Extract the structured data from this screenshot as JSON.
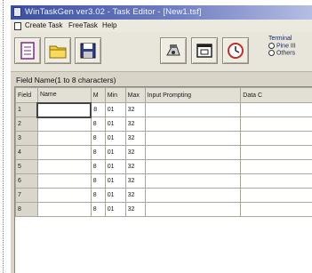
{
  "window": {
    "title": "WinTaskGen ver3.02 - Task Editor - [New1.tsf]"
  },
  "menu": {
    "items": [
      "Create Task",
      "FreeTask",
      "Help"
    ]
  },
  "toolbar": {
    "buttons": [
      {
        "icon": "new-document-icon"
      },
      {
        "icon": "open-folder-icon"
      },
      {
        "icon": "save-disk-icon"
      },
      {
        "icon": "terminal-device-icon"
      },
      {
        "icon": "window-icon"
      },
      {
        "icon": "clock-icon"
      }
    ],
    "terminal": {
      "label": "Terminal",
      "options": [
        "Pine III",
        "Others"
      ]
    }
  },
  "field_caption": "Field Name(1 to 8 characters)",
  "grid": {
    "columns": [
      "Field",
      "Name",
      "M",
      "Min",
      "Max",
      "Input Prompting",
      "Data C"
    ],
    "rows": [
      {
        "field": "1",
        "name": "",
        "m": "8",
        "min": "01",
        "max": "32"
      },
      {
        "field": "2",
        "name": "",
        "m": "8",
        "min": "01",
        "max": "32"
      },
      {
        "field": "3",
        "name": "",
        "m": "8",
        "min": "01",
        "max": "32"
      },
      {
        "field": "4",
        "name": "",
        "m": "8",
        "min": "01",
        "max": "32"
      },
      {
        "field": "5",
        "name": "",
        "m": "8",
        "min": "01",
        "max": "32"
      },
      {
        "field": "6",
        "name": "",
        "m": "8",
        "min": "01",
        "max": "32"
      },
      {
        "field": "7",
        "name": "",
        "m": "8",
        "min": "01",
        "max": "32"
      },
      {
        "field": "8",
        "name": "",
        "m": "8",
        "min": "01",
        "max": "32"
      }
    ]
  }
}
